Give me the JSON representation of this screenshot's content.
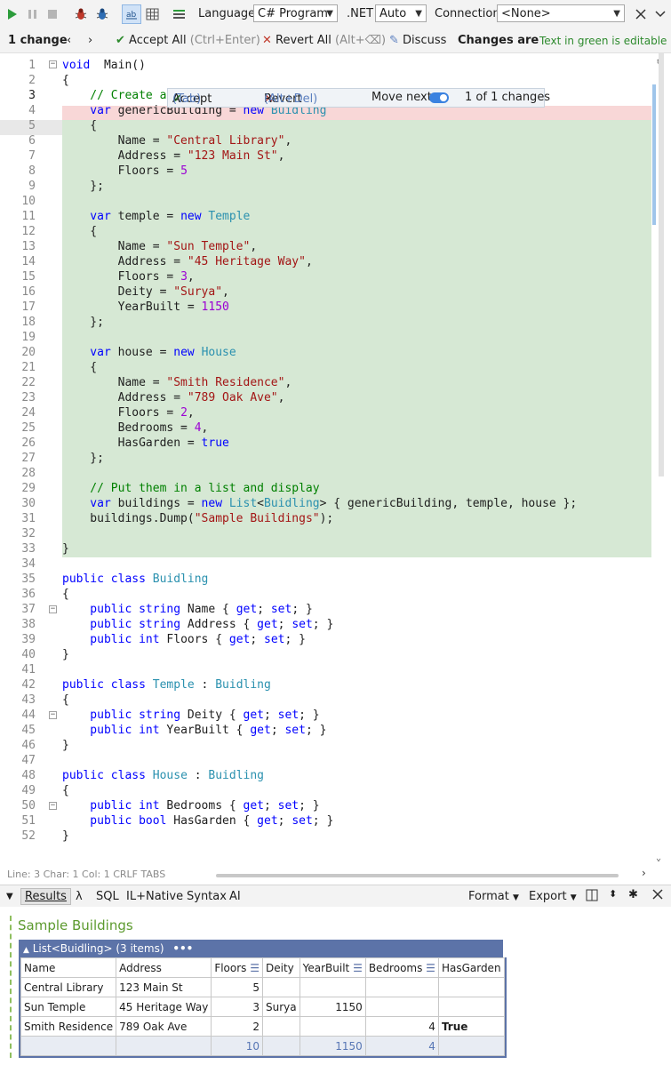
{
  "toolbar": {
    "language_label": "Language",
    "language_value": "C# Program",
    "dotnet_label": ".NET",
    "dotnet_value": "Auto",
    "connection_label": "Connection",
    "connection_value": "<None>"
  },
  "changebar": {
    "count": "1 change",
    "accept_all": "Accept All",
    "accept_all_shortcut": "(Ctrl+Enter)",
    "revert_all": "Revert All",
    "revert_all_shortcut": "(Alt+⌫)",
    "discuss": "Discuss",
    "changes_are": "Changes are",
    "green_editable": "Text in green is editable"
  },
  "inline_bar": {
    "accept": "Accept",
    "accept_shortcut": "(Tab)",
    "revert": "Revert",
    "revert_shortcut": "(Alt+Del)",
    "move_next": "Move next",
    "count": "1 of 1 changes"
  },
  "status": {
    "text": "Line: 3  Char: 1  Col: 1   CRLF  TABS"
  },
  "results_toolbar": {
    "results": "Results",
    "lambda": "λ",
    "sql": "SQL",
    "il": "IL+Native",
    "syntax": "Syntax",
    "ai": "AI",
    "format": "Format",
    "export": "Export"
  },
  "results": {
    "title": "Sample Buildings",
    "header": "List<Buidling> (3 items)",
    "columns": [
      "Name",
      "Address",
      "Floors",
      "Deity",
      "YearBuilt",
      "Bedrooms",
      "HasGarden"
    ],
    "rows": [
      [
        "Central Library",
        "123 Main St",
        "5",
        "",
        "",
        "",
        ""
      ],
      [
        "Sun Temple",
        "45 Heritage Way",
        "3",
        "Surya",
        "1150",
        "",
        ""
      ],
      [
        "Smith Residence",
        "789 Oak Ave",
        "2",
        "",
        "",
        "4",
        "True"
      ]
    ],
    "totals": [
      "",
      "",
      "10",
      "",
      "1150",
      "4",
      ""
    ]
  },
  "code_lines": [
    [
      [
        "kw",
        "void"
      ],
      [
        "",
        "  Main()"
      ]
    ],
    [
      [
        "",
        "{"
      ]
    ],
    [
      [
        "cm",
        "    // Create a few sample buildings"
      ]
    ],
    [
      [
        "kw",
        "    var"
      ],
      [
        "",
        " genericBuilding = "
      ],
      [
        "kw",
        "new"
      ],
      [
        "",
        " "
      ],
      [
        "ty",
        "Buidling"
      ]
    ],
    [
      [
        "",
        "    {"
      ]
    ],
    [
      [
        "",
        "        Name = "
      ],
      [
        "st",
        "\"Central Library\""
      ],
      [
        "",
        ","
      ]
    ],
    [
      [
        "",
        "        Address = "
      ],
      [
        "st",
        "\"123 Main St\""
      ],
      [
        "",
        ","
      ]
    ],
    [
      [
        "",
        "        Floors = "
      ],
      [
        "nm",
        "5"
      ]
    ],
    [
      [
        "",
        "    };"
      ]
    ],
    [
      [
        "",
        ""
      ]
    ],
    [
      [
        "kw",
        "    var"
      ],
      [
        "",
        " temple = "
      ],
      [
        "kw",
        "new"
      ],
      [
        "",
        " "
      ],
      [
        "ty",
        "Temple"
      ]
    ],
    [
      [
        "",
        "    {"
      ]
    ],
    [
      [
        "",
        "        Name = "
      ],
      [
        "st",
        "\"Sun Temple\""
      ],
      [
        "",
        ","
      ]
    ],
    [
      [
        "",
        "        Address = "
      ],
      [
        "st",
        "\"45 Heritage Way\""
      ],
      [
        "",
        ","
      ]
    ],
    [
      [
        "",
        "        Floors = "
      ],
      [
        "nm",
        "3"
      ],
      [
        "",
        ","
      ]
    ],
    [
      [
        "",
        "        Deity = "
      ],
      [
        "st",
        "\"Surya\""
      ],
      [
        "",
        ","
      ]
    ],
    [
      [
        "",
        "        YearBuilt = "
      ],
      [
        "nm",
        "1150"
      ]
    ],
    [
      [
        "",
        "    };"
      ]
    ],
    [
      [
        "",
        ""
      ]
    ],
    [
      [
        "kw",
        "    var"
      ],
      [
        "",
        " house = "
      ],
      [
        "kw",
        "new"
      ],
      [
        "",
        " "
      ],
      [
        "ty",
        "House"
      ]
    ],
    [
      [
        "",
        "    {"
      ]
    ],
    [
      [
        "",
        "        Name = "
      ],
      [
        "st",
        "\"Smith Residence\""
      ],
      [
        "",
        ","
      ]
    ],
    [
      [
        "",
        "        Address = "
      ],
      [
        "st",
        "\"789 Oak Ave\""
      ],
      [
        "",
        ","
      ]
    ],
    [
      [
        "",
        "        Floors = "
      ],
      [
        "nm",
        "2"
      ],
      [
        "",
        ","
      ]
    ],
    [
      [
        "",
        "        Bedrooms = "
      ],
      [
        "nm",
        "4"
      ],
      [
        "",
        ","
      ]
    ],
    [
      [
        "",
        "        HasGarden = "
      ],
      [
        "kw",
        "true"
      ]
    ],
    [
      [
        "",
        "    };"
      ]
    ],
    [
      [
        "",
        ""
      ]
    ],
    [
      [
        "cm",
        "    // Put them in a list and display"
      ]
    ],
    [
      [
        "kw",
        "    var"
      ],
      [
        "",
        " buildings = "
      ],
      [
        "kw",
        "new"
      ],
      [
        "",
        " "
      ],
      [
        "ty",
        "List"
      ],
      [
        "",
        "<"
      ],
      [
        "ty",
        "Buidling"
      ],
      [
        "",
        "> { genericBuilding, temple, house };"
      ]
    ],
    [
      [
        "",
        "    buildings.Dump("
      ],
      [
        "st",
        "\"Sample Buildings\""
      ],
      [
        "",
        ");"
      ]
    ],
    [
      [
        "",
        ""
      ]
    ],
    [
      [
        "",
        "}"
      ]
    ],
    [
      [
        "",
        ""
      ]
    ],
    [
      [
        "kw",
        "public"
      ],
      [
        "",
        " "
      ],
      [
        "kw",
        "class"
      ],
      [
        "",
        " "
      ],
      [
        "ty",
        "Buidling"
      ]
    ],
    [
      [
        "",
        "{"
      ]
    ],
    [
      [
        "kw",
        "    public"
      ],
      [
        "",
        " "
      ],
      [
        "kw",
        "string"
      ],
      [
        "",
        " Name { "
      ],
      [
        "kw",
        "get"
      ],
      [
        "",
        "; "
      ],
      [
        "kw",
        "set"
      ],
      [
        "",
        "; }"
      ]
    ],
    [
      [
        "kw",
        "    public"
      ],
      [
        "",
        " "
      ],
      [
        "kw",
        "string"
      ],
      [
        "",
        " Address { "
      ],
      [
        "kw",
        "get"
      ],
      [
        "",
        "; "
      ],
      [
        "kw",
        "set"
      ],
      [
        "",
        "; }"
      ]
    ],
    [
      [
        "kw",
        "    public"
      ],
      [
        "",
        " "
      ],
      [
        "kw",
        "int"
      ],
      [
        "",
        " Floors { "
      ],
      [
        "kw",
        "get"
      ],
      [
        "",
        "; "
      ],
      [
        "kw",
        "set"
      ],
      [
        "",
        "; }"
      ]
    ],
    [
      [
        "",
        "}"
      ]
    ],
    [
      [
        "",
        ""
      ]
    ],
    [
      [
        "kw",
        "public"
      ],
      [
        "",
        " "
      ],
      [
        "kw",
        "class"
      ],
      [
        "",
        " "
      ],
      [
        "ty",
        "Temple"
      ],
      [
        "",
        " : "
      ],
      [
        "ty",
        "Buidling"
      ]
    ],
    [
      [
        "",
        "{"
      ]
    ],
    [
      [
        "kw",
        "    public"
      ],
      [
        "",
        " "
      ],
      [
        "kw",
        "string"
      ],
      [
        "",
        " Deity { "
      ],
      [
        "kw",
        "get"
      ],
      [
        "",
        "; "
      ],
      [
        "kw",
        "set"
      ],
      [
        "",
        "; }"
      ]
    ],
    [
      [
        "kw",
        "    public"
      ],
      [
        "",
        " "
      ],
      [
        "kw",
        "int"
      ],
      [
        "",
        " YearBuilt { "
      ],
      [
        "kw",
        "get"
      ],
      [
        "",
        "; "
      ],
      [
        "kw",
        "set"
      ],
      [
        "",
        "; }"
      ]
    ],
    [
      [
        "",
        "}"
      ]
    ],
    [
      [
        "",
        ""
      ]
    ],
    [
      [
        "kw",
        "public"
      ],
      [
        "",
        " "
      ],
      [
        "kw",
        "class"
      ],
      [
        "",
        " "
      ],
      [
        "ty",
        "House"
      ],
      [
        "",
        " : "
      ],
      [
        "ty",
        "Buidling"
      ]
    ],
    [
      [
        "",
        "{"
      ]
    ],
    [
      [
        "kw",
        "    public"
      ],
      [
        "",
        " "
      ],
      [
        "kw",
        "int"
      ],
      [
        "",
        " Bedrooms { "
      ],
      [
        "kw",
        "get"
      ],
      [
        "",
        "; "
      ],
      [
        "kw",
        "set"
      ],
      [
        "",
        "; }"
      ]
    ],
    [
      [
        "kw",
        "    public"
      ],
      [
        "",
        " "
      ],
      [
        "kw",
        "bool"
      ],
      [
        "",
        " HasGarden { "
      ],
      [
        "kw",
        "get"
      ],
      [
        "",
        "; "
      ],
      [
        "kw",
        "set"
      ],
      [
        "",
        "; }"
      ]
    ],
    [
      [
        "",
        "}"
      ]
    ]
  ]
}
